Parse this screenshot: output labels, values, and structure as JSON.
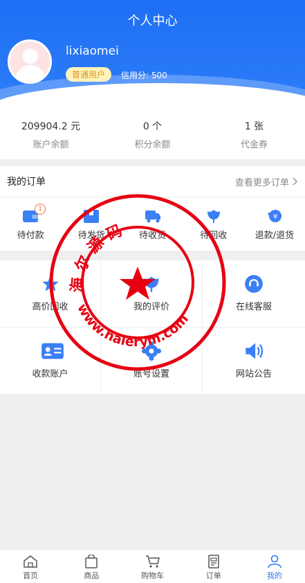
{
  "header": {
    "title": "个人中心",
    "username": "lixiaomei",
    "badge": "普通用户",
    "credit": "信用分: 500"
  },
  "stats": [
    {
      "value": "209904.2 元",
      "label": "账户余额"
    },
    {
      "value": "0 个",
      "label": "积分余额"
    },
    {
      "value": "1 张",
      "label": "代金券"
    }
  ],
  "orders": {
    "title": "我的订单",
    "more": "查看更多订单",
    "items": [
      {
        "label": "待付款",
        "badge": "1",
        "icon": "wallet-icon"
      },
      {
        "label": "待发货",
        "icon": "box-icon"
      },
      {
        "label": "待收货",
        "icon": "truck-icon"
      },
      {
        "label": "待回收",
        "icon": "flower-icon"
      },
      {
        "label": "退款/退货",
        "icon": "refund-icon"
      }
    ]
  },
  "grid": [
    {
      "label": "高价回收",
      "icon": "star-icon"
    },
    {
      "label": "我的评价",
      "icon": "flower-icon"
    },
    {
      "label": "在线客服",
      "icon": "service-icon"
    },
    {
      "label": "收款账户",
      "icon": "id-card-icon"
    },
    {
      "label": "账号设置",
      "icon": "gear-icon"
    },
    {
      "label": "网站公告",
      "icon": "speaker-icon"
    }
  ],
  "stamp": {
    "top": "海 尔 源 码",
    "bottom": "www.haierym.com"
  },
  "tabs": [
    {
      "label": "首页",
      "icon": "home-icon"
    },
    {
      "label": "商品",
      "icon": "bag-icon"
    },
    {
      "label": "购物车",
      "icon": "cart-icon"
    },
    {
      "label": "订单",
      "icon": "order-icon"
    },
    {
      "label": "我的",
      "icon": "user-icon",
      "active": true
    }
  ],
  "colors": {
    "primary": "#2a78f5",
    "icon_blue": "#3b7ff5",
    "stamp_red": "#e60012",
    "badge_bg": "#fff3b8"
  }
}
